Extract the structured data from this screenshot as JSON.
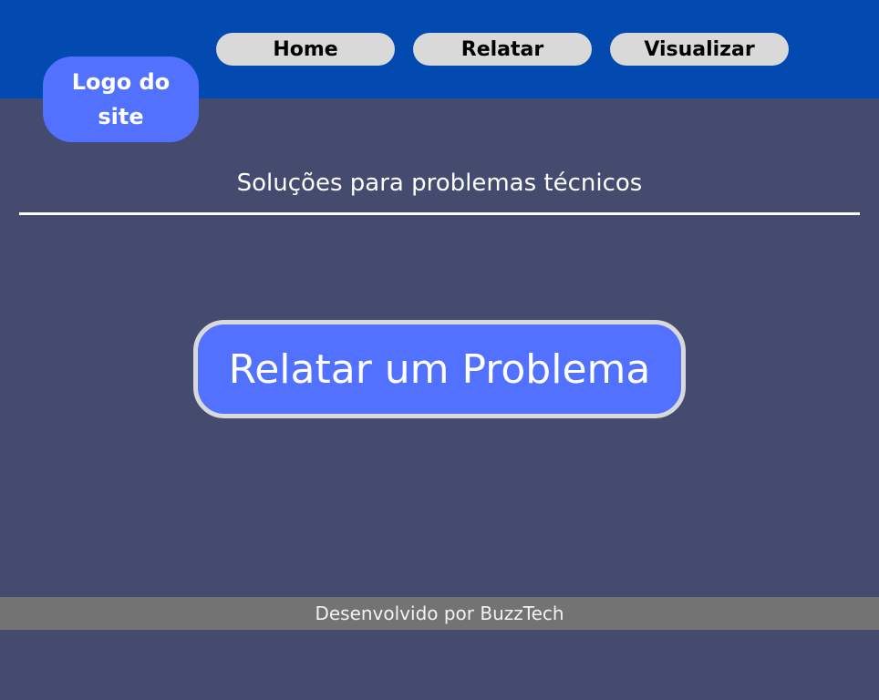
{
  "header": {
    "background_color": "#0249b0",
    "logo_text": "Logo do site",
    "nav": [
      {
        "label": "Home"
      },
      {
        "label": "Relatar"
      },
      {
        "label": "Visualizar"
      }
    ]
  },
  "main": {
    "subtitle": "Soluções para problemas técnicos",
    "cta_label": "Relatar um Problema",
    "background_color": "#444b6e",
    "accent_color": "#5271ff"
  },
  "footer": {
    "text": "Desenvolvido por BuzzTech",
    "background_color": "#737373"
  }
}
